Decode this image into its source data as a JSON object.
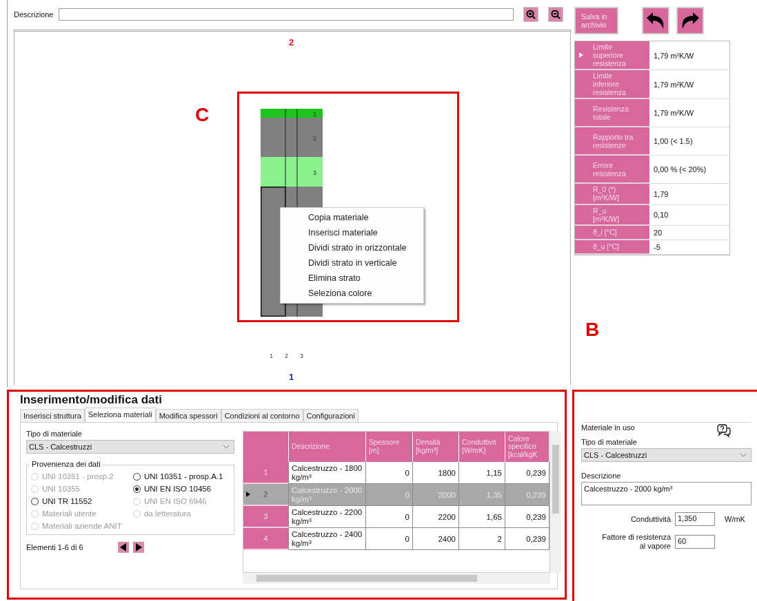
{
  "description_field": {
    "label": "Descrizione"
  },
  "toolbar": {
    "save_button": "Salva in archivio"
  },
  "canvas": {
    "top_label": "2",
    "bottom_label": "1",
    "column_numbers": [
      "1",
      "2",
      "3"
    ],
    "layers": [
      {
        "label": "1",
        "color": "#1ec41e",
        "selected": false
      },
      {
        "label": "2",
        "color": "#808080",
        "selected": false
      },
      {
        "label": "3",
        "color": "#8cf08c",
        "selected": false
      },
      {
        "color": "#808080",
        "selected": true
      }
    ],
    "context_menu": [
      "Copia materiale",
      "Inserisci materiale",
      "Dividi strato in orizzontale",
      "Dividi strato in verticale",
      "Elimina strato",
      "Seleziona colore"
    ]
  },
  "annotations": [
    {
      "label": "C"
    },
    {
      "label": "B"
    }
  ],
  "results": [
    {
      "label": "Limite superiore resistenza",
      "value": "1,79 m²K/W",
      "selected": true
    },
    {
      "label": "Limite inferiore resistenza",
      "value": "1,79 m²K/W",
      "selected": false
    },
    {
      "label": "Resistenza totale",
      "value": "1,79 m²K/W",
      "selected": false
    },
    {
      "label": "Rapporto tra resistenze",
      "value": "1,00 (< 1.5)",
      "selected": false
    },
    {
      "label": "Errore resistenza",
      "value": "0,00 % (< 20%)",
      "selected": false
    },
    {
      "label": "R_0 (*)[m²K/W]",
      "value": "1,79",
      "selected": false
    },
    {
      "label": "R_u [m²K/W]",
      "value": "0,10",
      "selected": false
    },
    {
      "label": "ϑ_i [°C]",
      "value": "20",
      "selected": false
    },
    {
      "label": "ϑ_u [°C]",
      "value": "-5",
      "selected": false
    }
  ],
  "data_panel": {
    "title": "Inserimento/modifica dati",
    "tabs": [
      {
        "label": "Inserisci struttura",
        "selected": false
      },
      {
        "label": "Seleziona materiali",
        "selected": true
      },
      {
        "label": "Modifica spessori",
        "selected": false
      },
      {
        "label": "Condizioni al contorno",
        "selected": false
      },
      {
        "label": "Configurazioni",
        "selected": false
      }
    ],
    "material_type": {
      "label": "Tipo di materiale",
      "value": "CLS - Calcestruzzi"
    },
    "provenance": {
      "title": "Provenienza dei dati",
      "options": [
        {
          "label": "UNI 10351 - prosp.2",
          "selected": false,
          "disabled": true
        },
        {
          "label": "UNI 10351 - prosp.A.1",
          "selected": false,
          "disabled": false
        },
        {
          "label": "UNI 10355",
          "selected": false,
          "disabled": true
        },
        {
          "label": "UNI EN ISO 10456",
          "selected": true,
          "disabled": false
        },
        {
          "label": "UNI TR 11552",
          "selected": false,
          "disabled": false
        },
        {
          "label": "UNI EN ISO 6946",
          "selected": false,
          "disabled": true
        },
        {
          "label": "Materiali utente",
          "selected": false,
          "disabled": true
        },
        {
          "label": "da letteratura",
          "selected": false,
          "disabled": true
        },
        {
          "label": "Materiali aziende ANIT",
          "selected": false,
          "disabled": true
        }
      ]
    },
    "footer": "Elementi 1-6 di 6",
    "table": {
      "columns": [
        "Descrizione",
        "Spessore [m]",
        "Densità [kg/m³]",
        "Conduttivit [W/mK]",
        "Calore specifico [kcal/kgK"
      ],
      "rows": [
        {
          "number": "1",
          "selected": false,
          "cells": [
            "Calcestruzzo - 1800 kg/m³",
            "0",
            "1800",
            "1,15",
            "0,239"
          ]
        },
        {
          "number": "2",
          "selected": true,
          "cells": [
            "Calcestruzzo - 2000 kg/m³",
            "0",
            "2000",
            "1,35",
            "0,239"
          ]
        },
        {
          "number": "3",
          "selected": false,
          "cells": [
            "Calcestruzzo - 2200 kg/m³",
            "0",
            "2200",
            "1,65",
            "0,239"
          ]
        },
        {
          "number": "4",
          "selected": false,
          "cells": [
            "Calcestruzzo - 2400 kg/m³",
            "0",
            "2400",
            "2",
            "0,239"
          ]
        }
      ]
    }
  },
  "material_panel": {
    "title": "Materiale in uso",
    "material_type": {
      "label": "Tipo di materiale",
      "value": "CLS - Calcestruzzi"
    },
    "description": {
      "label": "Descrizione",
      "value": "Calcestruzzo - 2000 kg/m³"
    },
    "conductivity": {
      "label": "Conduttività",
      "value": "1,350",
      "unit": "W/mK"
    },
    "vapour": {
      "label": "Fattore di resistenza al vapore",
      "value": "60"
    }
  }
}
